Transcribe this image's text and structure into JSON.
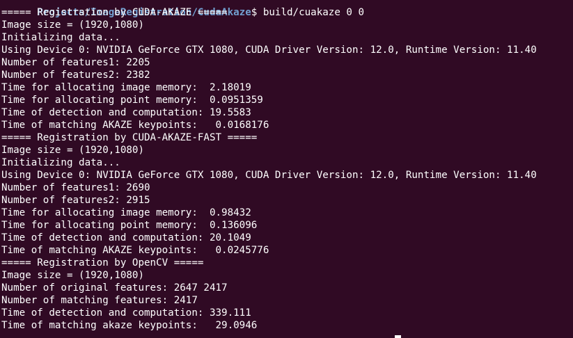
{
  "terminal": {
    "prompt": {
      "user_host": "",
      "path": "Projects/ImageRegistration/CudaAkaze",
      "symbol": "$",
      "command": " build/cuakaze 0 0"
    },
    "lines": [
      "===== Registration by CUDA-AKAZE =====",
      "Image size = (1920,1080)",
      "Initializing data...",
      "Using Device 0: NVIDIA GeForce GTX 1080, CUDA Driver Version: 12.0, Runtime Version: 11.40",
      "Number of features1: 2205",
      "Number of features2: 2382",
      "Time for allocating image memory:  2.18019",
      "Time for allocating point memory:  0.0951359",
      "Time of detection and computation: 19.5583",
      "Time of matching AKAZE keypoints:   0.0168176",
      "===== Registration by CUDA-AKAZE-FAST =====",
      "Image size = (1920,1080)",
      "Initializing data...",
      "Using Device 0: NVIDIA GeForce GTX 1080, CUDA Driver Version: 12.0, Runtime Version: 11.40",
      "Number of features1: 2690",
      "Number of features2: 2915",
      "Time for allocating image memory:  0.98432",
      "Time for allocating point memory:  0.136096",
      "Time of detection and computation: 20.1049",
      "Time of matching AKAZE keypoints:   0.0245776",
      "===== Registration by OpenCV =====",
      "Image size = (1920,1080)",
      "Number of original features: 2647 2417",
      "Number of matching features: 2417",
      "Time of detection and computation: 339.111",
      "Time of matching akaze keypoints:   29.0946"
    ]
  }
}
